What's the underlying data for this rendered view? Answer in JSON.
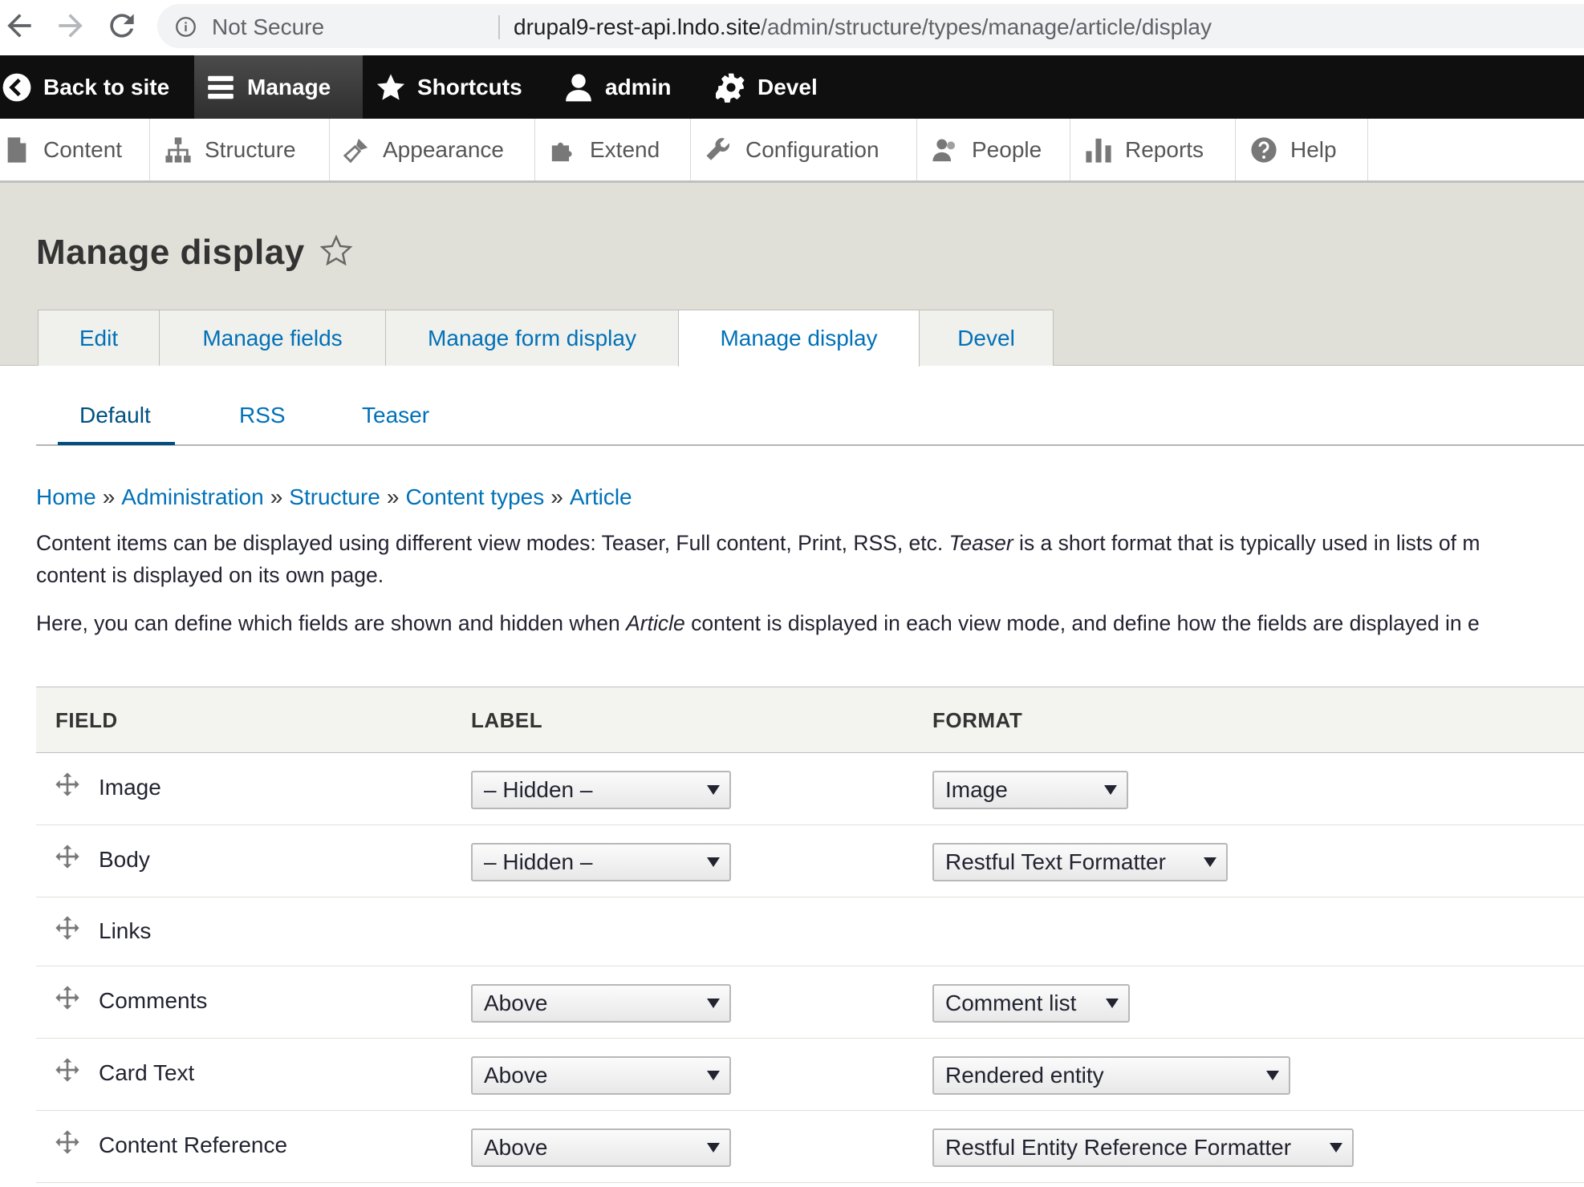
{
  "browser": {
    "security": "Not Secure",
    "url_host": "drupal9-rest-api.lndo.site",
    "url_path": "/admin/structure/types/manage/article/display"
  },
  "toolbar": {
    "back": "Back to site",
    "manage": "Manage",
    "shortcuts": "Shortcuts",
    "user": "admin",
    "devel": "Devel"
  },
  "tray": {
    "content": "Content",
    "structure": "Structure",
    "appearance": "Appearance",
    "extend": "Extend",
    "configuration": "Configuration",
    "people": "People",
    "reports": "Reports",
    "help": "Help"
  },
  "page": {
    "title": "Manage display"
  },
  "tabs": {
    "edit": "Edit",
    "manage_fields": "Manage fields",
    "manage_form_display": "Manage form display",
    "manage_display": "Manage display",
    "devel": "Devel"
  },
  "subtabs": {
    "default": "Default",
    "rss": "RSS",
    "teaser": "Teaser"
  },
  "breadcrumb": {
    "home": "Home",
    "administration": "Administration",
    "structure": "Structure",
    "content_types": "Content types",
    "article": "Article",
    "separator": "»"
  },
  "help": {
    "p1_a": "Content items can be displayed using different view modes: Teaser, Full content, Print, RSS, etc. ",
    "p1_em": "Teaser",
    "p1_b": " is a short format that is typically used in lists of m",
    "p1_c": "content is displayed on its own page.",
    "p2_a": "Here, you can define which fields are shown and hidden when ",
    "p2_em": "Article",
    "p2_b": " content is displayed in each view mode, and define how the fields are displayed in e"
  },
  "table": {
    "headers": {
      "field": "FIELD",
      "label": "LABEL",
      "format": "FORMAT"
    },
    "rows": [
      {
        "field": "Image",
        "label": "– Hidden –",
        "format": "Image"
      },
      {
        "field": "Body",
        "label": "– Hidden –",
        "format": "Restful Text Formatter"
      },
      {
        "field": "Links",
        "label": "",
        "format": ""
      },
      {
        "field": "Comments",
        "label": "Above",
        "format": "Comment list"
      },
      {
        "field": "Card Text",
        "label": "Above",
        "format": "Rendered entity"
      },
      {
        "field": "Content Reference",
        "label": "Above",
        "format": "Restful Entity Reference Formatter"
      }
    ]
  }
}
